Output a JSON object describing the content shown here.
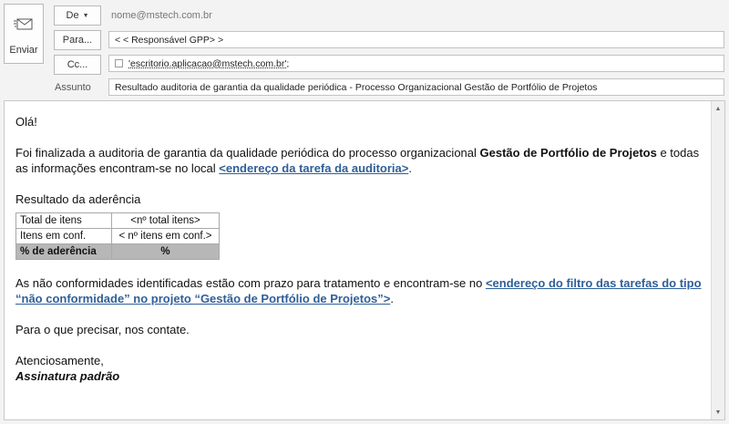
{
  "compose": {
    "send_label": "Enviar",
    "from_label": "De",
    "from_value": "nome@mstech.com.br",
    "to_label": "Para...",
    "to_value": "< < Responsável GPP> >",
    "cc_label": "Cc...",
    "cc_value": "'escritorio.aplicacao@mstech.com.br';",
    "subject_label": "Assunto",
    "subject_value": "Resultado auditoria de garantia da qualidade periódica - Processo Organizacional Gestão de Portfólio de Projetos"
  },
  "message": {
    "greeting": "Olá!",
    "para1_a": "Foi finalizada a  auditoria de garantia da qualidade periódica do processo organizacional ",
    "para1_bold": "Gestão de Portfólio de Projetos",
    "para1_b": " e todas as informações encontram-se no local ",
    "para1_link": "<endereço da tarefa da auditoria>",
    "para1_end": ".",
    "result_heading": "Resultado da aderência",
    "table": [
      {
        "label": "Total de itens",
        "value": "<nº total itens>"
      },
      {
        "label": "Itens em conf.",
        "value": "< nº itens em conf.>"
      },
      {
        "label": "% de aderência",
        "value": "%"
      }
    ],
    "para2_a": "As não conformidades identificadas estão com prazo para tratamento e encontram-se no ",
    "para2_link": "<endereço do filtro das tarefas do tipo “não conformidade” no projeto “Gestão de Portfólio de Projetos”>",
    "para2_end": ".",
    "closing_line": "Para o que precisar, nos contate.",
    "regards": "Atenciosamente,",
    "signature": "Assinatura padrão"
  },
  "icons": {
    "send": "send-envelope-icon",
    "dropdown": "chevron-down-icon",
    "scroll_up": "scroll-up-arrow-icon",
    "scroll_down": "scroll-down-arrow-icon"
  },
  "colors": {
    "link": "#2f5f98",
    "table_highlight": "#b7b7b7"
  }
}
